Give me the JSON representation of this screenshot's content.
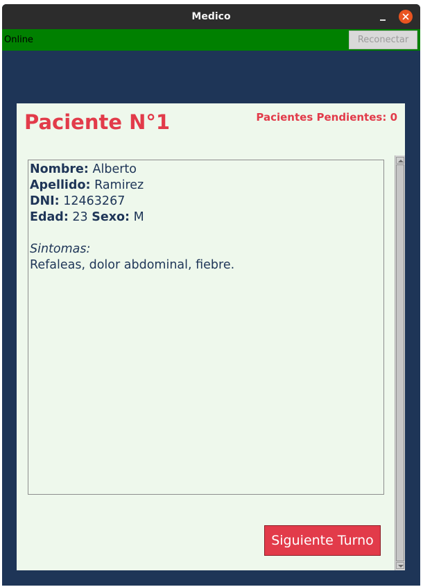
{
  "window": {
    "title": "Medico"
  },
  "statusbar": {
    "status_text": "Online",
    "status_color": "#008000",
    "reconnect_label": "Reconectar"
  },
  "panel": {
    "patient_title": "Paciente N°1",
    "pending_label": "Pacientes Pendientes:",
    "pending_count": "0"
  },
  "patient": {
    "nombre_label": "Nombre:",
    "nombre_value": "Alberto",
    "apellido_label": "Apellido:",
    "apellido_value": "Ramirez",
    "dni_label": "DNI:",
    "dni_value": "12463267",
    "edad_label": "Edad:",
    "edad_value": "23",
    "sexo_label": "Sexo:",
    "sexo_value": "M",
    "sintomas_label": "Sintomas:",
    "sintomas_value": "Refaleas, dolor abdominal, fiebre."
  },
  "actions": {
    "next_label": "Siguiente Turno"
  },
  "icons": {
    "minimize": "minimize-icon",
    "close": "close-icon",
    "scroll_up": "arrow-up-icon",
    "scroll_down": "arrow-down-icon"
  },
  "colors": {
    "background": "#1e3557",
    "accent": "#e23b4a",
    "panel": "#eef8ec",
    "close_button": "#e95420"
  }
}
